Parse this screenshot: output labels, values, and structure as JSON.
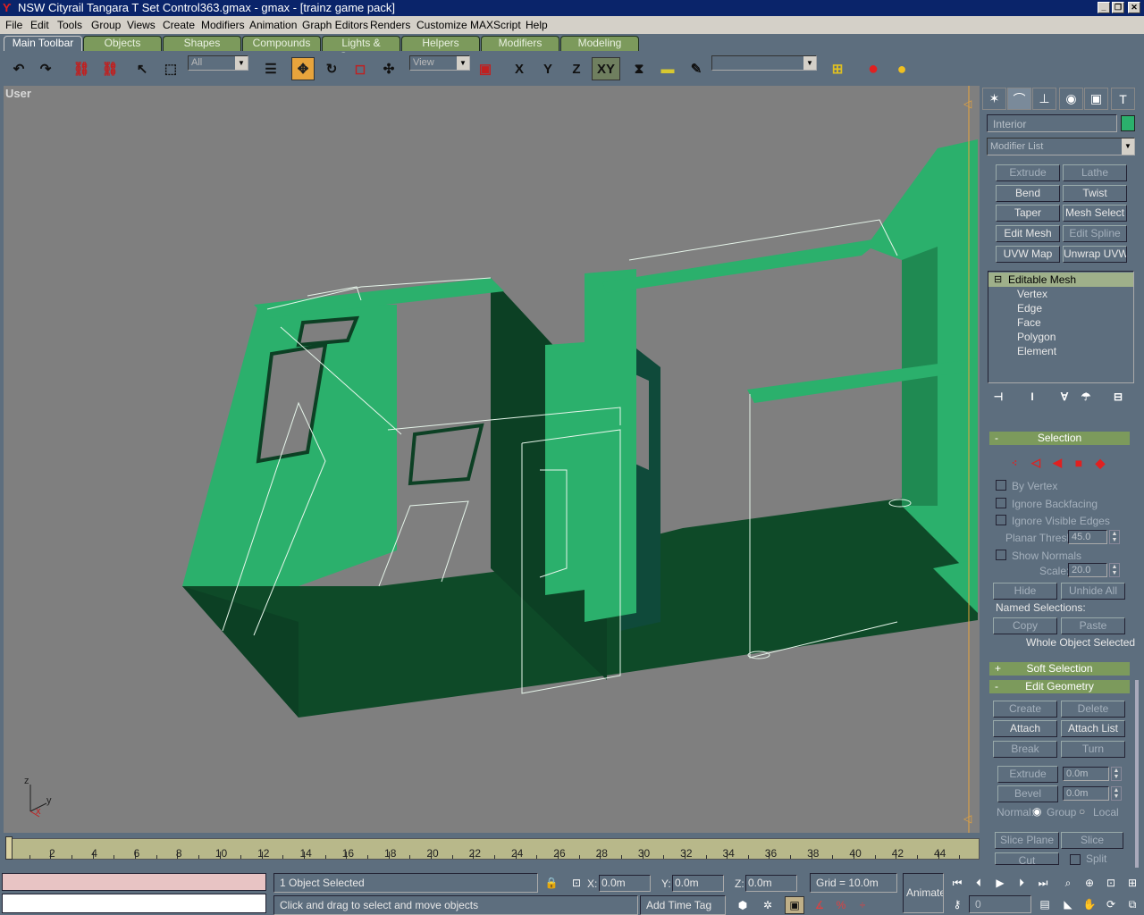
{
  "titlebar": {
    "title": "NSW Cityrail Tangara T Set Control363.gmax - gmax - [trainz game pack]"
  },
  "menu": [
    "File",
    "Edit",
    "Tools",
    "Group",
    "Views",
    "Create",
    "Modifiers",
    "Animation",
    "Graph Editors",
    "Renders",
    "Customize",
    "MAXScript",
    "Help"
  ],
  "tabs": [
    "Main Toolbar",
    "Objects",
    "Shapes",
    "Compounds",
    "Lights & Cameras",
    "Helpers",
    "Modifiers",
    "Modeling"
  ],
  "toolbar": {
    "selection_filter": "All",
    "ref_coord": "View",
    "axis_x": "X",
    "axis_y": "Y",
    "axis_z": "Z",
    "axis_xy": "XY",
    "named_sel": ""
  },
  "viewport": {
    "label": "User",
    "axis_x": "x",
    "axis_y": "y",
    "axis_z": "z"
  },
  "panel": {
    "object_name": "Interior",
    "object_color": "#2bb06c",
    "modifier_list": "Modifier List",
    "mod_buttons": [
      {
        "label": "Extrude",
        "disabled": true
      },
      {
        "label": "Lathe",
        "disabled": true
      },
      {
        "label": "Bend",
        "disabled": false
      },
      {
        "label": "Twist",
        "disabled": false
      },
      {
        "label": "Taper",
        "disabled": false
      },
      {
        "label": "Mesh Select",
        "disabled": false
      },
      {
        "label": "Edit Mesh",
        "disabled": false
      },
      {
        "label": "Edit Spline",
        "disabled": true
      },
      {
        "label": "UVW Map",
        "disabled": false
      },
      {
        "label": "Unwrap UVW",
        "disabled": false
      }
    ],
    "stack": {
      "root": "Editable Mesh",
      "items": [
        "Vertex",
        "Edge",
        "Face",
        "Polygon",
        "Element"
      ]
    },
    "selection": {
      "title": "Selection",
      "by_vertex": "By Vertex",
      "ignore_backfacing": "Ignore Backfacing",
      "ignore_visible_edges": "Ignore Visible Edges",
      "planar_thresh_label": "Planar Thresh:",
      "planar_thresh": "45.0",
      "show_normals": "Show Normals",
      "scale_label": "Scale:",
      "scale": "20.0",
      "hide": "Hide",
      "unhide_all": "Unhide All",
      "named_selections": "Named Selections:",
      "copy": "Copy",
      "paste": "Paste",
      "status": "Whole Object Selected"
    },
    "soft_selection": "Soft Selection",
    "edit_geometry": {
      "title": "Edit Geometry",
      "create": "Create",
      "delete": "Delete",
      "attach": "Attach",
      "attach_list": "Attach List",
      "break": "Break",
      "turn": "Turn",
      "extrude": "Extrude",
      "extrude_val": "0.0m",
      "bevel": "Bevel",
      "bevel_val": "0.0m",
      "normal": "Normal:",
      "group": "Group",
      "local": "Local",
      "slice_plane": "Slice Plane",
      "slice": "Slice",
      "cut": "Cut",
      "split": "Split"
    },
    "plus": "+",
    "minus": "-"
  },
  "timeline": {
    "ticks": [
      "2",
      "4",
      "6",
      "8",
      "10",
      "12",
      "14",
      "16",
      "18",
      "20",
      "22",
      "24",
      "26",
      "28",
      "30",
      "32",
      "34",
      "36",
      "38",
      "40",
      "42",
      "44"
    ]
  },
  "status": {
    "selected": "1 Object Selected",
    "prompt": "Click and drag to select and move objects",
    "x_label": "X:",
    "x": "0.0m",
    "y_label": "Y:",
    "y": "0.0m",
    "z_label": "Z:",
    "z": "0.0m",
    "grid": "Grid = 10.0m",
    "add_time_tag": "Add Time Tag",
    "animate": "Animate",
    "frame": "0"
  }
}
